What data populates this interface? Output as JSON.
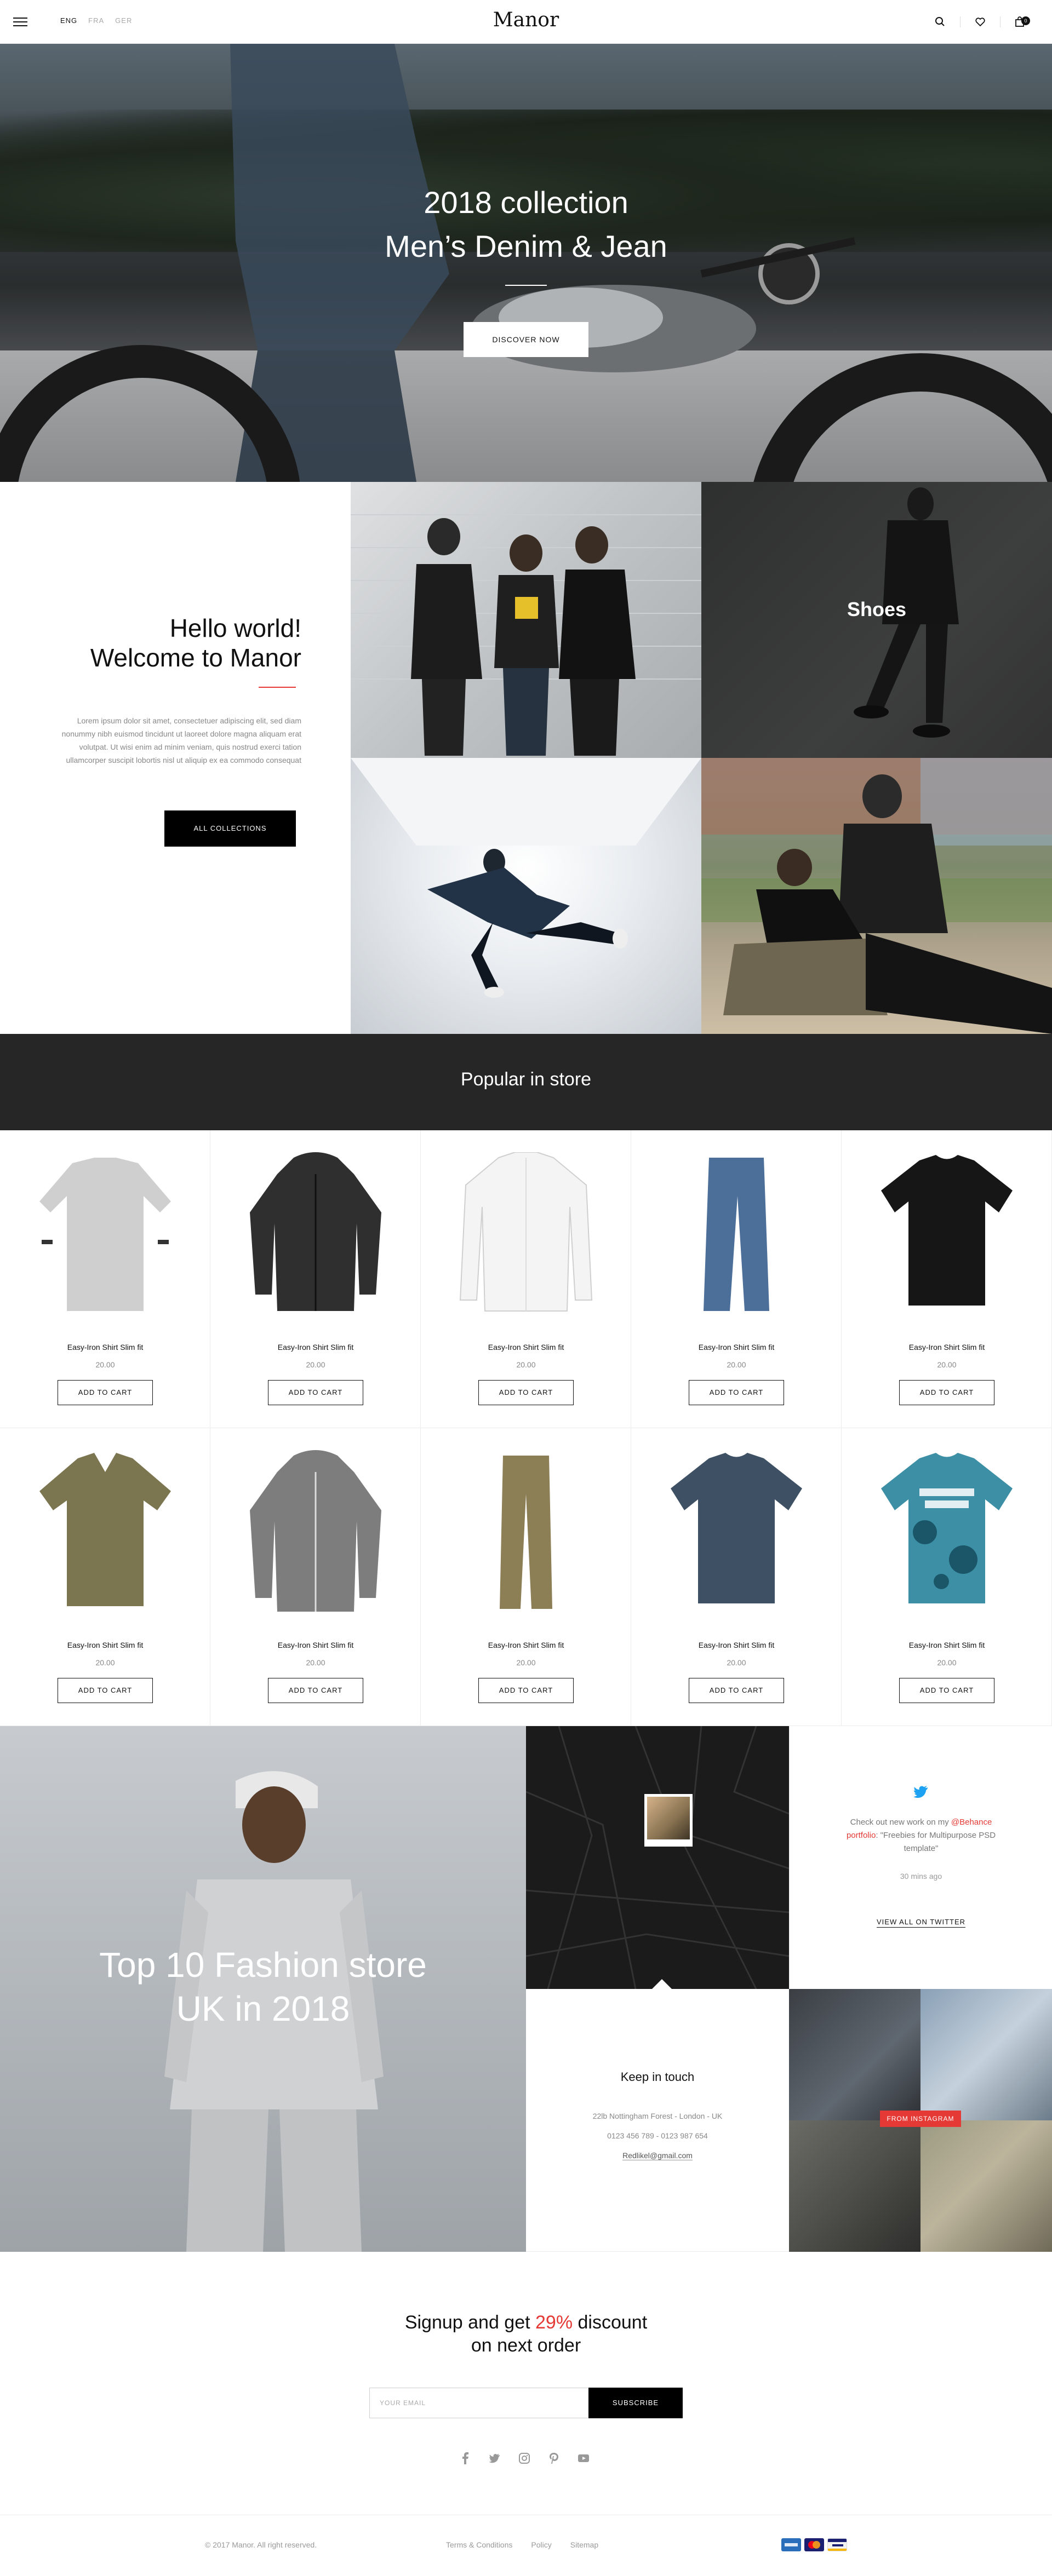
{
  "header": {
    "languages": [
      {
        "label": "ENG",
        "active": true
      },
      {
        "label": "FRA",
        "active": false
      },
      {
        "label": "GER",
        "active": false
      }
    ],
    "logo": "Manor",
    "cart_count": "0",
    "icons": [
      "menu-icon",
      "search-icon",
      "heart-icon",
      "cart-icon"
    ]
  },
  "hero": {
    "title_line1": "2018 collection",
    "title_line2": "Men’s Denim & Jean",
    "button": "DISCOVER NOW"
  },
  "welcome": {
    "title_line1": "Hello world!",
    "title_line2": "Welcome to Manor",
    "text": "Lorem ipsum dolor sit amet, consectetuer adipiscing elit, sed diam nonummy nibh euismod tincidunt ut laoreet dolore magna aliquam erat volutpat. Ut wisi enim ad minim veniam, quis nostrud exerci tation ullamcorper suscipit lobortis nisl ut aliquip ex ea commodo consequat",
    "button": "ALL COLLECTIONS",
    "accent": "#e53935"
  },
  "tiles": {
    "shoes_label": "Shoes"
  },
  "popular": {
    "title": "Popular in store",
    "products": [
      {
        "name": "Easy-Iron Shirt Slim fit",
        "price": "20.00",
        "button": "ADD TO CART",
        "item": "grey-sweater",
        "color": "#cfcfcf"
      },
      {
        "name": "Easy-Iron Shirt Slim fit",
        "price": "20.00",
        "button": "ADD TO CART",
        "item": "black-hoodie",
        "color": "#2f2f2f"
      },
      {
        "name": "Easy-Iron Shirt Slim fit",
        "price": "20.00",
        "button": "ADD TO CART",
        "item": "white-shirt",
        "color": "#f4f4f4"
      },
      {
        "name": "Easy-Iron Shirt Slim fit",
        "price": "20.00",
        "button": "ADD TO CART",
        "item": "blue-jeans",
        "color": "#4b6f99"
      },
      {
        "name": "Easy-Iron Shirt Slim fit",
        "price": "20.00",
        "button": "ADD TO CART",
        "item": "black-tshirt",
        "color": "#161616"
      },
      {
        "name": "Easy-Iron Shirt Slim fit",
        "price": "20.00",
        "button": "ADD TO CART",
        "item": "olive-tshirt",
        "color": "#7b7550"
      },
      {
        "name": "Easy-Iron Shirt Slim fit",
        "price": "20.00",
        "button": "ADD TO CART",
        "item": "grey-hoodie",
        "color": "#7d7d7d"
      },
      {
        "name": "Easy-Iron Shirt Slim fit",
        "price": "20.00",
        "button": "ADD TO CART",
        "item": "khaki-trousers",
        "color": "#8c7f56"
      },
      {
        "name": "Easy-Iron Shirt Slim fit",
        "price": "20.00",
        "button": "ADD TO CART",
        "item": "navy-tshirt",
        "color": "#3e5064"
      },
      {
        "name": "Easy-Iron Shirt Slim fit",
        "price": "20.00",
        "button": "ADD TO CART",
        "item": "tie-dye-tshirt",
        "color": "#3d8fa6"
      }
    ]
  },
  "feature": {
    "title_line1": "Top 10 Fashion store",
    "title_line2": "UK in 2018"
  },
  "twitter": {
    "text_before": "Check out new work on my ",
    "handle": "@Behance",
    "text_link": "portfolio",
    "text_after": ": \"Freebies for Multipurpose PSD template\"",
    "time": "30 mins ago",
    "link": "VIEW ALL ON TWITTER"
  },
  "contact": {
    "title": "Keep in touch",
    "address": "22lb Nottingham Forest - London - UK",
    "phones": "0123 456 789  -  0123 987 654",
    "email": "Redlikel@gmail.com"
  },
  "instagram": {
    "badge": "FROM INSTAGRAM"
  },
  "signup": {
    "title_before": "Signup and get ",
    "percent": "29%",
    "title_after": " discount",
    "title_line2": "on next order",
    "email_placeholder": "YOUR EMAIL",
    "button": "SUBSCRIBE",
    "socials": [
      "facebook-icon",
      "twitter-icon",
      "instagram-icon",
      "pinterest-icon",
      "youtube-icon"
    ]
  },
  "footer": {
    "copyright": "© 2017 Manor. All right reserved.",
    "links": [
      "Terms & Conditions",
      "Policy",
      "Sitemap"
    ],
    "payments": [
      "amex-icon",
      "mastercard-icon",
      "visa-icon"
    ]
  }
}
